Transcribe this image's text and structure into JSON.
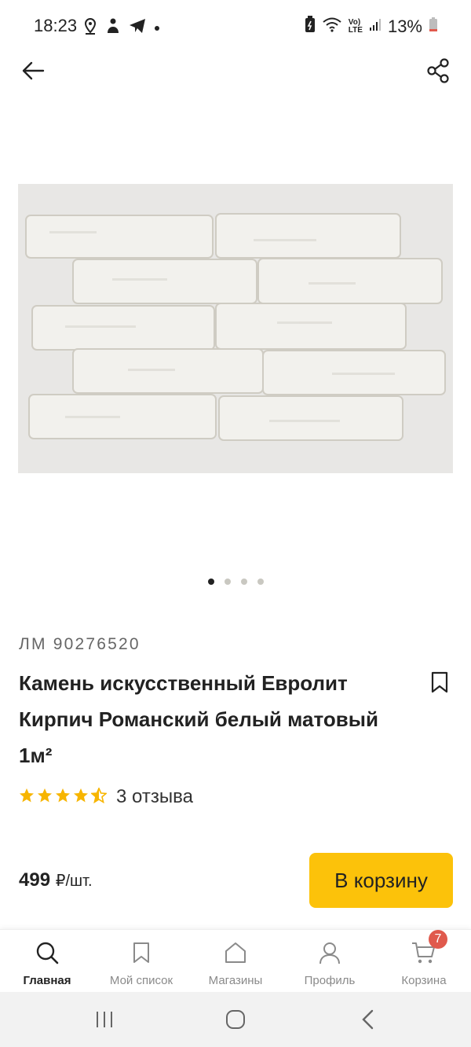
{
  "status_bar": {
    "time": "18:23",
    "battery_percent": "13%",
    "network_label_top": "Vo)",
    "network_label_bottom": "LTE",
    "icons": [
      "location-icon",
      "person-icon",
      "telegram-icon",
      "dot-icon",
      "battery-saver-icon",
      "wifi-icon",
      "volte-icon",
      "signal-icon",
      "battery-icon"
    ]
  },
  "top_bar": {
    "back_icon": "arrow-left-icon",
    "share_icon": "share-icon"
  },
  "gallery": {
    "image_alt": "white-brick-stone-panel",
    "image_count": 4,
    "active_index": 0
  },
  "product": {
    "article": "ЛМ 90276520",
    "title": "Камень искусственный Евролит Кирпич Романский белый матовый 1м²",
    "rating": 4.5,
    "reviews": "3 отзыва",
    "price_value": "499",
    "price_unit": "₽/шт.",
    "cart_button_label": "В корзину",
    "accent_color": "#fcc20a"
  },
  "bottom_nav": {
    "items": [
      {
        "label": "Главная",
        "icon": "search-icon",
        "active": true
      },
      {
        "label": "Мой список",
        "icon": "bookmark-icon",
        "active": false
      },
      {
        "label": "Магазины",
        "icon": "house-icon",
        "active": false
      },
      {
        "label": "Профиль",
        "icon": "person-icon",
        "active": false
      },
      {
        "label": "Корзина",
        "icon": "cart-icon",
        "active": false,
        "badge": "7"
      }
    ]
  },
  "system_nav": {
    "buttons": [
      "recents-icon",
      "home-icon",
      "back-icon"
    ]
  }
}
